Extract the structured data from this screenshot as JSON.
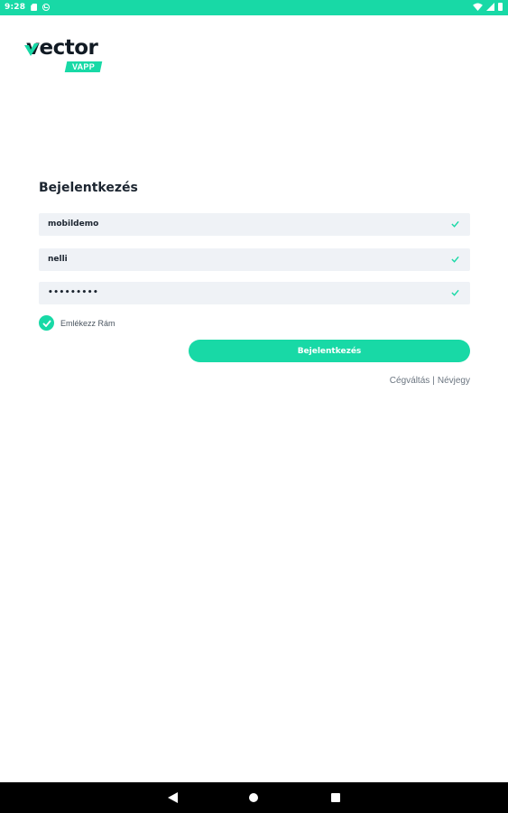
{
  "status_bar": {
    "time": "9:28",
    "icons": [
      "sd-card-icon",
      "sync-icon",
      "wifi-icon",
      "signal-icon",
      "battery-icon"
    ]
  },
  "logo": {
    "wordmark": "vector",
    "badge": "VAPP"
  },
  "login": {
    "title": "Bejelentkezés",
    "username": {
      "value": "mobildemo",
      "valid": true
    },
    "company": {
      "value": "nelli",
      "valid": true
    },
    "password": {
      "value": "•••••••••",
      "valid": true
    },
    "remember_me": {
      "label": "Emlékezz Rám",
      "checked": true
    },
    "submit_label": "Bejelentkezés"
  },
  "links": {
    "switch_company": "Cégváltás",
    "separator": "|",
    "business_card": "Névjegy"
  },
  "navigation": {
    "icons": [
      "back-icon",
      "home-icon",
      "recents-icon"
    ]
  },
  "colors": {
    "accent": "#18d9a6",
    "text": "#1c2530",
    "field_background": "#eff2f6",
    "nav_bar": "#000000"
  }
}
